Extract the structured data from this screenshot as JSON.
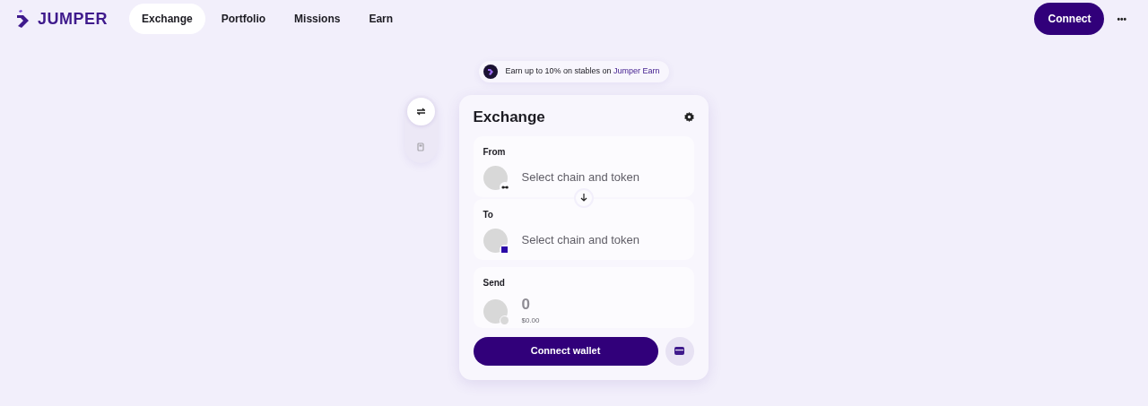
{
  "brand": {
    "name": "JUMPER"
  },
  "nav": [
    {
      "label": "Exchange",
      "selected": true
    },
    {
      "label": "Portfolio",
      "selected": false
    },
    {
      "label": "Missions",
      "selected": false
    },
    {
      "label": "Earn",
      "selected": false
    }
  ],
  "connect_button": "Connect",
  "more_button": "•••",
  "banner": {
    "text": "Earn up to 10% on stables on ",
    "link": "Jumper Earn"
  },
  "side_tools": [
    {
      "kind": "swap",
      "selected": true
    },
    {
      "kind": "gas",
      "selected": false
    }
  ],
  "exchange": {
    "title": "Exchange",
    "sections": [
      {
        "kind": "token",
        "label": "From",
        "placeholder": "Select chain and token"
      },
      {
        "kind": "token",
        "label": "To",
        "placeholder": "Select chain and token"
      },
      {
        "kind": "amount",
        "label": "Send",
        "value": "0",
        "fiat": "$0.00"
      }
    ],
    "submit": "Connect wallet"
  }
}
